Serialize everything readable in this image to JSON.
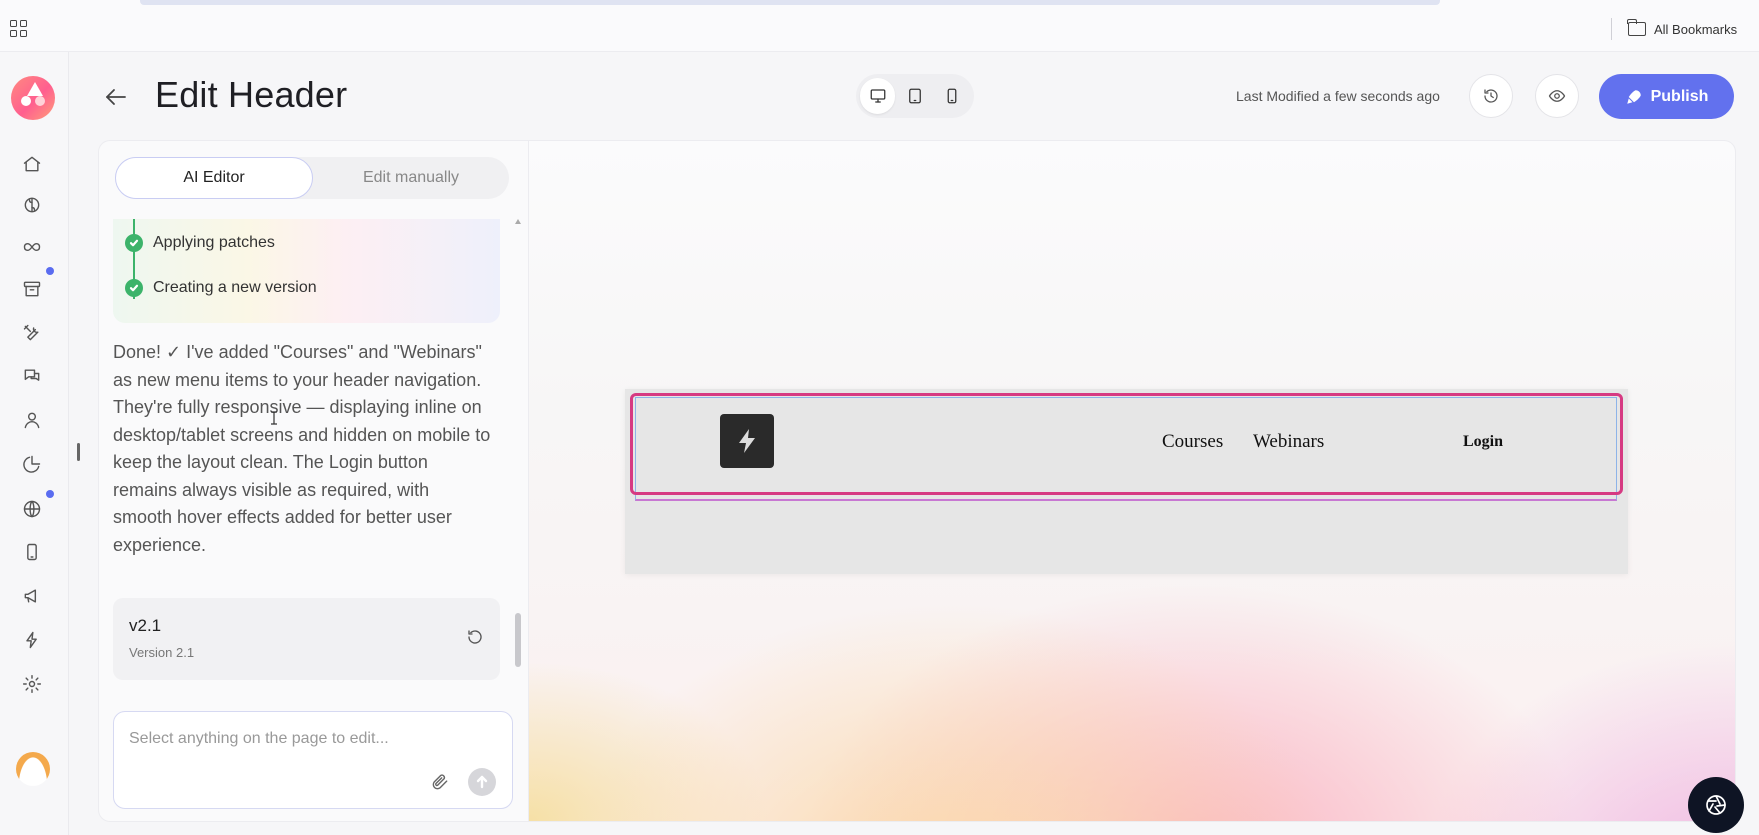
{
  "browser": {
    "bookmarks_label": "All Bookmarks"
  },
  "rail": {
    "items": [
      {
        "name": "home-icon"
      },
      {
        "name": "brain-icon"
      },
      {
        "name": "infinity-icon"
      },
      {
        "name": "archive-icon",
        "badge": true
      },
      {
        "name": "tools-icon"
      },
      {
        "name": "chat-icon"
      },
      {
        "name": "user-icon"
      },
      {
        "name": "pie-chart-icon"
      },
      {
        "name": "globe-icon",
        "badge": true
      },
      {
        "name": "mobile-icon"
      },
      {
        "name": "megaphone-icon"
      },
      {
        "name": "lightning-icon"
      },
      {
        "name": "settings-icon"
      }
    ],
    "badge_color": "#5a6cf0"
  },
  "header": {
    "title": "Edit Header",
    "last_modified": "Last Modified a few seconds ago",
    "publish_label": "Publish",
    "publish_color": "#6271ee",
    "device_modes": [
      "desktop",
      "tablet",
      "mobile"
    ],
    "active_device": "desktop"
  },
  "editor": {
    "tabs": [
      {
        "label": "AI Editor",
        "active": true
      },
      {
        "label": "Edit manually",
        "active": false
      }
    ],
    "steps": [
      {
        "label": "Applying patches",
        "status": "done"
      },
      {
        "label": "Creating a new version",
        "status": "done"
      }
    ],
    "message": "Done! ✓ I've added \"Courses\" and \"Webinars\" as new menu items to your header navigation. They're fully responsive — displaying inline on desktop/tablet screens and hidden on mobile to keep the layout clean. The Login button remains always visible as required, with smooth hover effects added for better user experience.",
    "version": {
      "name": "v2.1",
      "subtitle": "Version 2.1"
    },
    "input_placeholder": "Select anything on the page to edit..."
  },
  "preview": {
    "nav_items": [
      "Courses",
      "Webinars"
    ],
    "login_label": "Login",
    "selection_color": "#d63a82"
  }
}
